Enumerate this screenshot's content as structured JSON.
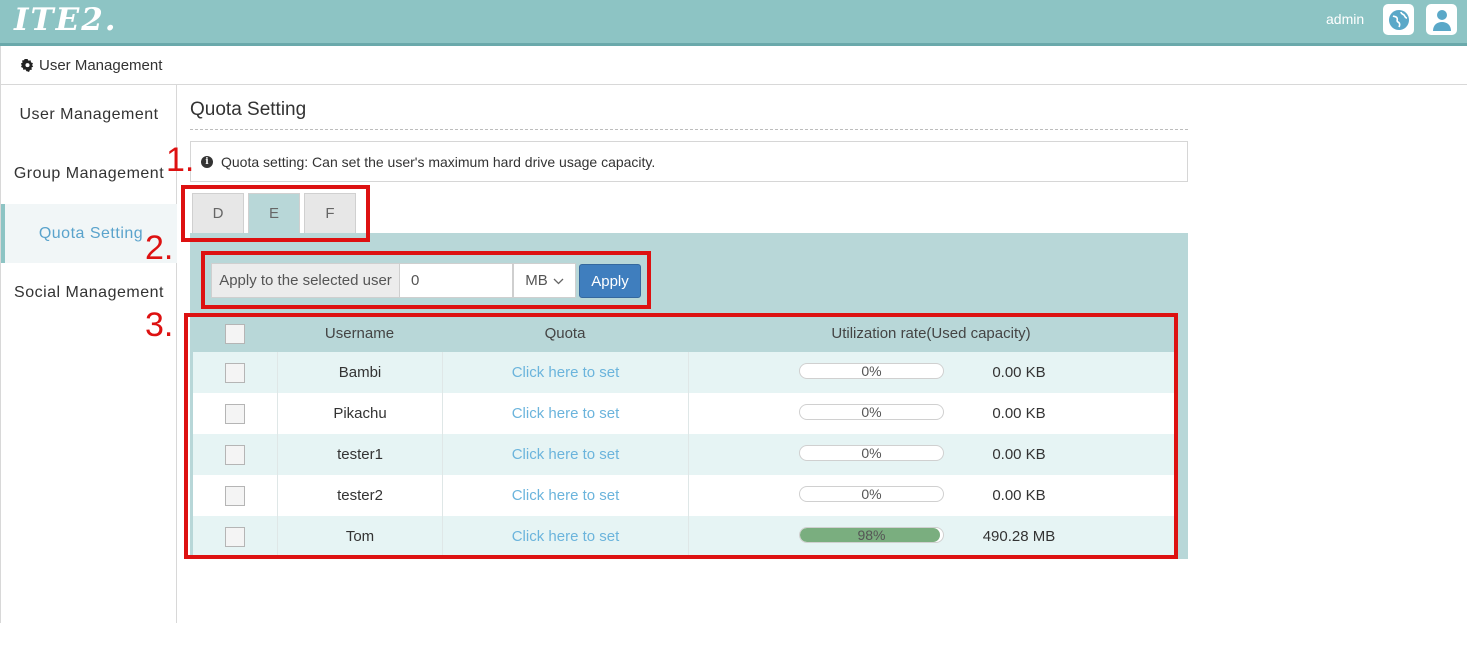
{
  "header": {
    "logo": "ITE2.",
    "username": "admin",
    "language_icon": "globe-icon",
    "user_icon": "person-icon"
  },
  "breadcrumb": {
    "icon": "gear-icon",
    "label": "User Management"
  },
  "sidebar": {
    "items": [
      {
        "label": "User Management",
        "active": false
      },
      {
        "label": "Group Management",
        "active": false
      },
      {
        "label": "Quota Setting",
        "active": true
      },
      {
        "label": "Social Management",
        "active": false
      }
    ]
  },
  "main": {
    "title": "Quota Setting",
    "info_icon": "info-icon",
    "info_text": "Quota setting: Can set the user's maximum hard drive usage capacity.",
    "tabs": [
      {
        "label": "D",
        "active": false
      },
      {
        "label": "E",
        "active": true
      },
      {
        "label": "F",
        "active": false
      }
    ],
    "apply": {
      "label": "Apply to the selected user",
      "value": "0",
      "unit": "MB",
      "button": "Apply"
    },
    "table": {
      "headers": {
        "username": "Username",
        "quota": "Quota",
        "utilization": "Utilization rate(Used capacity)"
      },
      "rows": [
        {
          "username": "Bambi",
          "quota": "Click here to set",
          "percent": "0%",
          "fraction": 0.0,
          "used": "0.00 KB"
        },
        {
          "username": "Pikachu",
          "quota": "Click here to set",
          "percent": "0%",
          "fraction": 0.0,
          "used": "0.00 KB"
        },
        {
          "username": "tester1",
          "quota": "Click here to set",
          "percent": "0%",
          "fraction": 0.0,
          "used": "0.00 KB"
        },
        {
          "username": "tester2",
          "quota": "Click here to set",
          "percent": "0%",
          "fraction": 0.0,
          "used": "0.00 KB"
        },
        {
          "username": "Tom",
          "quota": "Click here to set",
          "percent": "98%",
          "fraction": 0.98,
          "used": "490.28 MB"
        }
      ]
    }
  },
  "annotations": [
    "1.",
    "2.",
    "3."
  ],
  "colors": {
    "header": "#8dc4c4",
    "panel": "#b8d7d8",
    "accent_button": "#3f7ebe",
    "link": "#6bb4dc",
    "progress": "#7aae7f",
    "annotation": "#dd1111"
  }
}
